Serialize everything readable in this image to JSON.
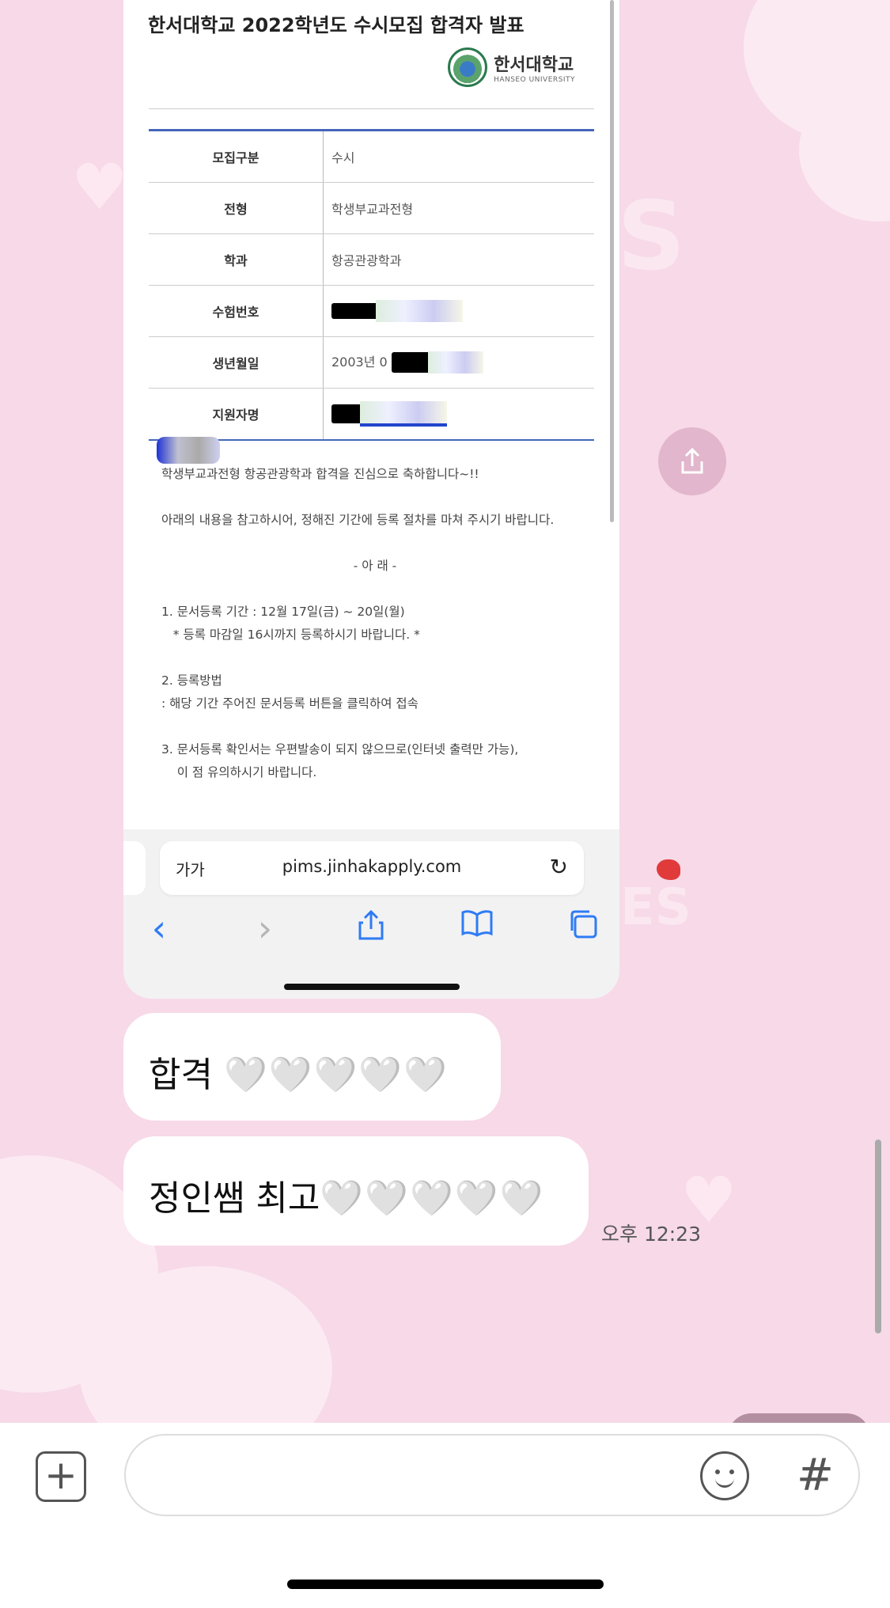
{
  "document": {
    "title": "한서대학교 2022학년도 수시모집 합격자 발표",
    "logo_ko": "한서대학교",
    "logo_en": "HANSEO UNIVERSITY",
    "rows": [
      {
        "label": "모집구분",
        "value": "수시"
      },
      {
        "label": "전형",
        "value": "학생부교과전형"
      },
      {
        "label": "학과",
        "value": "항공관광학과"
      },
      {
        "label": "수험번호",
        "value": ""
      },
      {
        "label": "생년월일",
        "value": "2003년 0"
      },
      {
        "label": "지원자명",
        "value": ""
      }
    ],
    "body": {
      "congrats": "학생부교과전형 항공관광학과 합격을 진심으로 축하합니다~!!",
      "notice": "아래의 내용을 참고하시어, 정해진 기간에 등록 절차를 마쳐 주시기 바랍니다.",
      "below": "- 아 래 -",
      "item1": "1. 문서등록 기간 : 12월 17일(금) ~ 20일(월)",
      "item1_note": "* 등록 마감일 16시까지 등록하시기 바랍니다. *",
      "item2": "2. 등록방법",
      "item2_note": ": 해당 기간 주어진 문서등록 버튼을 클릭하여 접속",
      "item3": "3. 문서등록 확인서는 우편발송이 되지 않으므로(인터넷 출력만 가능),",
      "item3_note": "이 점 유의하시기 바랍니다."
    }
  },
  "browser": {
    "aa": "가가",
    "url": "pims.jinhakapply.com",
    "reload_icon": "↻",
    "back_icon": "‹",
    "forward_icon": "›"
  },
  "chat": {
    "messages": [
      {
        "text": "합격",
        "hearts": "🤍🤍🤍🤍🤍"
      },
      {
        "text": "정인쌤 최고",
        "hearts": "🤍🤍🤍🤍🤍"
      }
    ],
    "timestamp": "오후 12:23"
  },
  "input": {
    "placeholder": "",
    "hash": "#",
    "add": "+"
  },
  "colors": {
    "background": "#f7d9e8",
    "browser_accent": "#2f7bf5",
    "table_border": "#4466bb"
  }
}
